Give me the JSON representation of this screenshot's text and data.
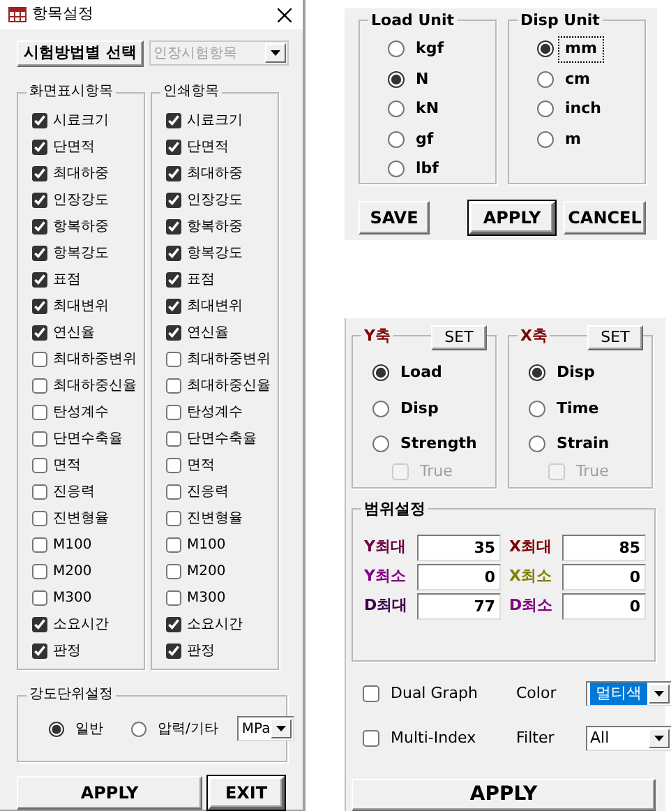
{
  "item_settings": {
    "title": "항목설정",
    "test_method_button": "시험방법별 선택",
    "test_method_combo": {
      "value": "인장시험항목",
      "disabled": true
    },
    "display_items": {
      "title": "화면표시항목",
      "items": [
        {
          "label": "시료크기",
          "checked": true
        },
        {
          "label": "단면적",
          "checked": true
        },
        {
          "label": "최대하중",
          "checked": true
        },
        {
          "label": "인장강도",
          "checked": true
        },
        {
          "label": "항복하중",
          "checked": true
        },
        {
          "label": "항복강도",
          "checked": true
        },
        {
          "label": "표점",
          "checked": true
        },
        {
          "label": "최대변위",
          "checked": true
        },
        {
          "label": "연신율",
          "checked": true
        },
        {
          "label": "최대하중변위",
          "checked": false
        },
        {
          "label": "최대하중신율",
          "checked": false
        },
        {
          "label": "탄성계수",
          "checked": false
        },
        {
          "label": "단면수축율",
          "checked": false
        },
        {
          "label": "면적",
          "checked": false
        },
        {
          "label": "진응력",
          "checked": false
        },
        {
          "label": "진변형율",
          "checked": false
        },
        {
          "label": "M100",
          "checked": false
        },
        {
          "label": "M200",
          "checked": false
        },
        {
          "label": "M300",
          "checked": false
        },
        {
          "label": "소요시간",
          "checked": true
        },
        {
          "label": "판정",
          "checked": true
        }
      ]
    },
    "print_items": {
      "title": "인쇄항목",
      "items": [
        {
          "label": "시료크기",
          "checked": true
        },
        {
          "label": "단면적",
          "checked": true
        },
        {
          "label": "최대하중",
          "checked": true
        },
        {
          "label": "인장강도",
          "checked": true
        },
        {
          "label": "항복하중",
          "checked": true
        },
        {
          "label": "항복강도",
          "checked": true
        },
        {
          "label": "표점",
          "checked": true
        },
        {
          "label": "최대변위",
          "checked": true
        },
        {
          "label": "연신율",
          "checked": true
        },
        {
          "label": "최대하중변위",
          "checked": false
        },
        {
          "label": "최대하중신율",
          "checked": false
        },
        {
          "label": "탄성계수",
          "checked": false
        },
        {
          "label": "단면수축율",
          "checked": false
        },
        {
          "label": "면적",
          "checked": false
        },
        {
          "label": "진응력",
          "checked": false
        },
        {
          "label": "진변형율",
          "checked": false
        },
        {
          "label": "M100",
          "checked": false
        },
        {
          "label": "M200",
          "checked": false
        },
        {
          "label": "M300",
          "checked": false
        },
        {
          "label": "소요시간",
          "checked": true
        },
        {
          "label": "판정",
          "checked": true
        }
      ]
    },
    "strength_unit": {
      "title": "강도단위설정",
      "options": [
        {
          "label": "일반",
          "selected": true
        },
        {
          "label": "압력/기타",
          "selected": false
        }
      ],
      "unit_combo": "MPa"
    },
    "buttons": [
      {
        "label": "APPLY",
        "default": false
      },
      {
        "label": "EXIT",
        "default": true
      }
    ]
  },
  "unit_settings": {
    "load_unit": {
      "title": "Load Unit",
      "options": [
        {
          "label": "kgf",
          "selected": false,
          "focused": false
        },
        {
          "label": "N",
          "selected": true,
          "focused": false
        },
        {
          "label": "kN",
          "selected": false,
          "focused": false
        },
        {
          "label": "gf",
          "selected": false,
          "focused": false
        },
        {
          "label": "lbf",
          "selected": false,
          "focused": false
        }
      ]
    },
    "disp_unit": {
      "title": "Disp Unit",
      "options": [
        {
          "label": "mm",
          "selected": true,
          "focused": true
        },
        {
          "label": "cm",
          "selected": false,
          "focused": false
        },
        {
          "label": "inch",
          "selected": false,
          "focused": false
        },
        {
          "label": "m",
          "selected": false,
          "focused": false
        }
      ]
    },
    "buttons": [
      {
        "label": "SAVE",
        "default": false
      },
      {
        "label": "APPLY",
        "default": true
      },
      {
        "label": "CANCEL",
        "default": false
      }
    ]
  },
  "graph_settings": {
    "y_axis": {
      "title": "Y축",
      "set_button": "SET",
      "options": [
        {
          "label": "Load",
          "selected": true
        },
        {
          "label": "Disp",
          "selected": false
        },
        {
          "label": "Strength",
          "selected": false
        }
      ],
      "true_checkbox": {
        "label": "True",
        "checked": false,
        "disabled": true
      }
    },
    "x_axis": {
      "title": "X축",
      "set_button": "SET",
      "options": [
        {
          "label": "Disp",
          "selected": true
        },
        {
          "label": "Time",
          "selected": false
        },
        {
          "label": "Strain",
          "selected": false
        }
      ],
      "true_checkbox": {
        "label": "True",
        "checked": false,
        "disabled": true
      }
    },
    "range": {
      "title": "범위설정",
      "fields": [
        {
          "label": "Y최대",
          "value": "35",
          "color": "#700040"
        },
        {
          "label": "X최대",
          "value": "85",
          "color": "#800000"
        },
        {
          "label": "Y최소",
          "value": "0",
          "color": "#800080"
        },
        {
          "label": "X최소",
          "value": "0",
          "color": "#808000"
        },
        {
          "label": "D최대",
          "value": "77",
          "color": "#400050"
        },
        {
          "label": "D최소",
          "value": "0",
          "color": "#800080"
        }
      ]
    },
    "dual_graph": {
      "label": "Dual Graph",
      "checked": false
    },
    "multi_index": {
      "label": "Multi-Index",
      "checked": false
    },
    "color": {
      "label": "Color",
      "value": "멀티색",
      "highlighted": true
    },
    "filter": {
      "label": "Filter",
      "value": "All",
      "highlighted": false
    },
    "apply_button": "APPLY"
  }
}
